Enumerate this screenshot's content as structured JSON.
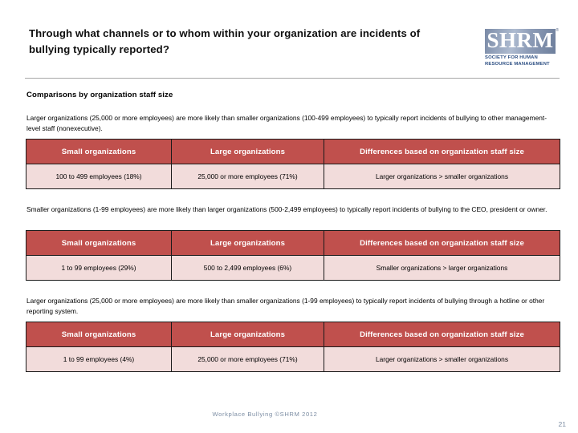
{
  "slide": {
    "title": "Through what channels or to whom within your organization are incidents of bullying typically reported?",
    "section_heading": "Comparisons by organization staff size",
    "accent_color": "#c0504d",
    "table_body_color": "#f2dcdb",
    "footer_color": "#7c8da3"
  },
  "logo": {
    "mark_text": "SHRM",
    "trademark": "®",
    "subtitle": "Society for Human Resource Management"
  },
  "comparisons": [
    {
      "intro": "Larger organizations (25,000 or more employees) are more likely than smaller organizations (100-499 employees) to typically report incidents of bullying to other management-level staff (nonexecutive).",
      "headers": [
        "Small organizations",
        "Large organizations",
        "Differences based on organization staff size"
      ],
      "cells": [
        "100 to 499 employees (18%)",
        "25,000 or more employees (71%)",
        "Larger organizations > smaller organizations"
      ]
    },
    {
      "intro": "Smaller organizations (1-99 employees) are more likely than larger organizations (500-2,499 employees) to typically report incidents of bullying to the CEO, president or owner.",
      "headers": [
        "Small organizations",
        "Large organizations",
        "Differences based on organization staff size"
      ],
      "cells": [
        "1 to 99 employees (29%)",
        "500 to 2,499 employees (6%)",
        "Smaller organizations > larger organizations"
      ]
    },
    {
      "intro": "Larger organizations (25,000 or more employees) are more likely than smaller organizations (1-99 employees) to typically report incidents of bullying through a hotline or other reporting system.",
      "headers": [
        "Small organizations",
        "Large organizations",
        "Differences based on organization staff size"
      ],
      "cells": [
        "1 to 99 employees (4%)",
        "25,000 or more employees (71%)",
        "Larger organizations > smaller organizations"
      ]
    }
  ],
  "footer": {
    "note": "Workplace Bullying ©SHRM 2012",
    "page_number": "21"
  }
}
